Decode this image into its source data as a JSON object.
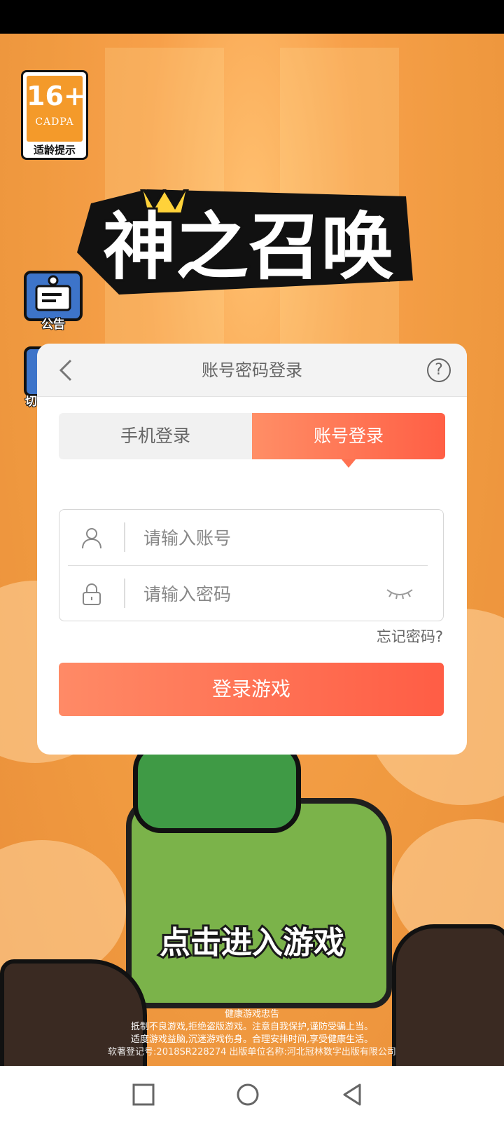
{
  "age_rating": {
    "number": "16+",
    "org": "CADPA",
    "tip": "适龄提示"
  },
  "logo": {
    "text": "神之召唤"
  },
  "side_buttons": {
    "notice": "公告",
    "switch": "切"
  },
  "dialog": {
    "title": "账号密码登录",
    "help_symbol": "?",
    "tabs": [
      {
        "label": "手机登录"
      },
      {
        "label": "账号登录"
      }
    ],
    "account_input": {
      "placeholder": "请输入账号",
      "value": ""
    },
    "password_input": {
      "placeholder": "请输入密码",
      "value": ""
    },
    "forgot_label": "忘记密码?",
    "login_label": "登录游戏"
  },
  "tap_hint": "点击进入游戏",
  "footer": {
    "title": "健康游戏忠告",
    "line1": "抵制不良游戏,拒绝盗版游戏。注意自我保护,谨防受骗上当。",
    "line2": "适度游戏益脑,沉迷游戏伤身。合理安排时间,享受健康生活。",
    "line3": "软著登记号:2018SR228274 出版单位名称:河北冠林数字出版有限公司"
  },
  "colors": {
    "accent": "#ff6b4f",
    "background": "#f09a40",
    "text_gray": "#666666"
  },
  "icons": [
    "back-icon",
    "help-icon",
    "user-icon",
    "lock-icon",
    "eye-closed-icon",
    "square-nav-icon",
    "circle-nav-icon",
    "triangle-back-icon"
  ]
}
